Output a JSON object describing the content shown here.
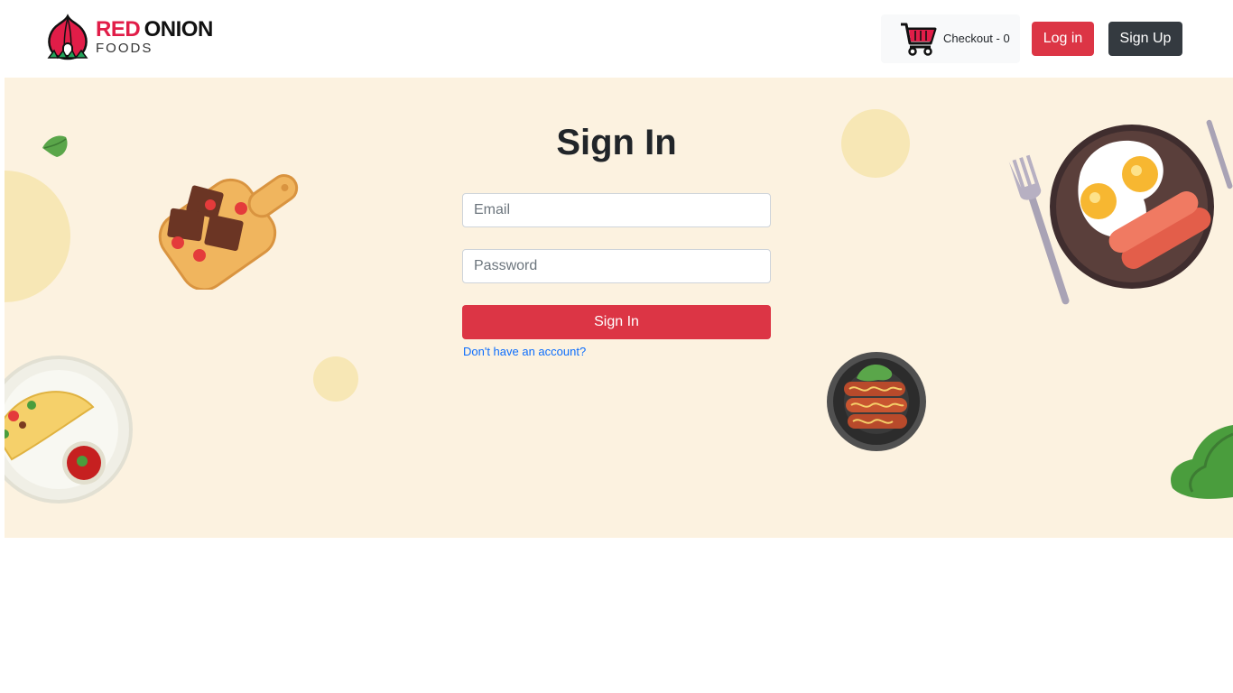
{
  "brand": {
    "word_red": "RED",
    "word_onion": "ONION",
    "word_foods": "FOODS"
  },
  "nav": {
    "checkout_label": "Checkout - 0",
    "login_label": "Log in",
    "signup_label": "Sign Up"
  },
  "form": {
    "title": "Sign In",
    "email_placeholder": "Email",
    "password_placeholder": "Password",
    "submit_label": "Sign In",
    "account_link": "Don't have an account?"
  },
  "colors": {
    "brand_red": "#e11d48",
    "button_red": "#dc3545",
    "button_dark": "#343a40",
    "hero_bg": "#fcf2e0",
    "link_blue": "#0d6efd"
  },
  "icons": [
    "onion-logo-icon",
    "shopping-cart-icon"
  ]
}
